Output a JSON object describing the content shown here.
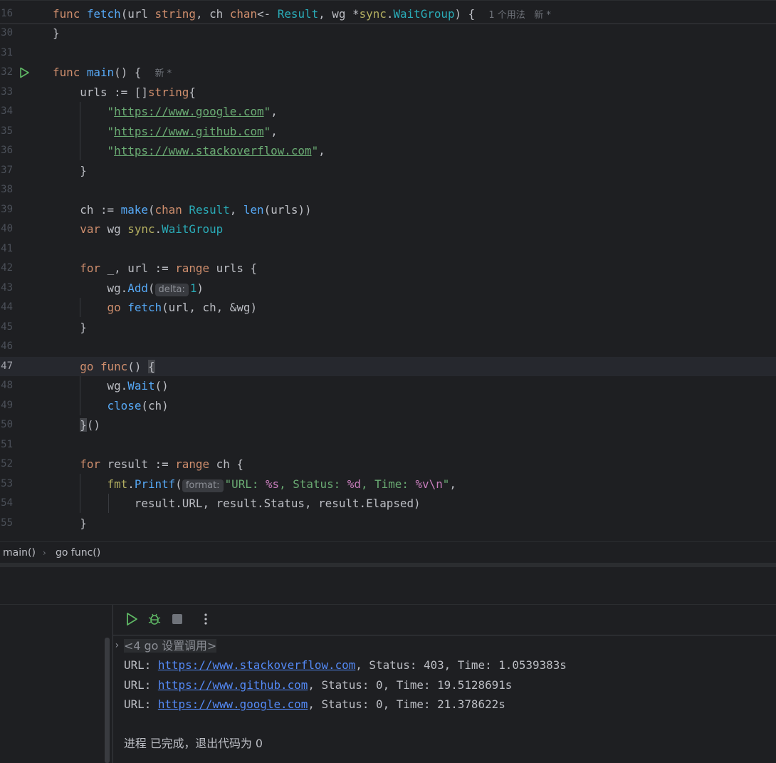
{
  "editor": {
    "sticky": {
      "line_no": "16",
      "tokens": [
        {
          "t": "func ",
          "c": "kw"
        },
        {
          "t": "fetch",
          "c": "fn"
        },
        {
          "t": "(url ",
          "c": ""
        },
        {
          "t": "string",
          "c": "kw"
        },
        {
          "t": ", ch ",
          "c": ""
        },
        {
          "t": "chan",
          "c": "kw"
        },
        {
          "t": "<- ",
          "c": ""
        },
        {
          "t": "Result",
          "c": "ty"
        },
        {
          "t": ", wg *",
          "c": ""
        },
        {
          "t": "sync",
          "c": "pk"
        },
        {
          "t": ".",
          "c": ""
        },
        {
          "t": "WaitGroup",
          "c": "ty"
        },
        {
          "t": ") {  ",
          "c": ""
        }
      ],
      "hint": "1 个用法   新 *"
    },
    "lines": [
      {
        "no": "30",
        "tokens": [
          {
            "t": "}",
            "c": ""
          }
        ]
      },
      {
        "no": "31",
        "tokens": []
      },
      {
        "no": "32",
        "run": true,
        "tokens": [
          {
            "t": "func ",
            "c": "kw"
          },
          {
            "t": "main",
            "c": "fn"
          },
          {
            "t": "() {  ",
            "c": ""
          }
        ],
        "hint": "新 *"
      },
      {
        "no": "33",
        "tokens": [
          {
            "t": "    urls := []",
            "c": ""
          },
          {
            "t": "string",
            "c": "kw"
          },
          {
            "t": "{",
            "c": ""
          }
        ]
      },
      {
        "no": "34",
        "tokens": [
          {
            "t": "        ",
            "c": ""
          },
          {
            "t": "\"",
            "c": "st"
          },
          {
            "t": "https://www.google.com",
            "c": "url"
          },
          {
            "t": "\"",
            "c": "st"
          },
          {
            "t": ",",
            "c": ""
          }
        ]
      },
      {
        "no": "35",
        "tokens": [
          {
            "t": "        ",
            "c": ""
          },
          {
            "t": "\"",
            "c": "st"
          },
          {
            "t": "https://www.github.com",
            "c": "url"
          },
          {
            "t": "\"",
            "c": "st"
          },
          {
            "t": ",",
            "c": ""
          }
        ]
      },
      {
        "no": "36",
        "tokens": [
          {
            "t": "        ",
            "c": ""
          },
          {
            "t": "\"",
            "c": "st"
          },
          {
            "t": "https://www.stackoverflow.com",
            "c": "url"
          },
          {
            "t": "\"",
            "c": "st"
          },
          {
            "t": ",",
            "c": ""
          }
        ]
      },
      {
        "no": "37",
        "tokens": [
          {
            "t": "    }",
            "c": ""
          }
        ]
      },
      {
        "no": "38",
        "tokens": []
      },
      {
        "no": "39",
        "tokens": [
          {
            "t": "    ch := ",
            "c": ""
          },
          {
            "t": "make",
            "c": "fn"
          },
          {
            "t": "(",
            "c": ""
          },
          {
            "t": "chan ",
            "c": "kw"
          },
          {
            "t": "Result",
            "c": "ty"
          },
          {
            "t": ", ",
            "c": ""
          },
          {
            "t": "len",
            "c": "fn"
          },
          {
            "t": "(urls))",
            "c": ""
          }
        ]
      },
      {
        "no": "40",
        "tokens": [
          {
            "t": "    ",
            "c": ""
          },
          {
            "t": "var ",
            "c": "kw"
          },
          {
            "t": "wg ",
            "c": ""
          },
          {
            "t": "sync",
            "c": "pk"
          },
          {
            "t": ".",
            "c": ""
          },
          {
            "t": "WaitGroup",
            "c": "ty"
          }
        ]
      },
      {
        "no": "41",
        "tokens": []
      },
      {
        "no": "42",
        "tokens": [
          {
            "t": "    ",
            "c": ""
          },
          {
            "t": "for ",
            "c": "kw"
          },
          {
            "t": "_, url := ",
            "c": ""
          },
          {
            "t": "range ",
            "c": "kw"
          },
          {
            "t": "urls {",
            "c": ""
          }
        ]
      },
      {
        "no": "43",
        "tokens": [
          {
            "t": "        wg.",
            "c": ""
          },
          {
            "t": "Add",
            "c": "fn"
          },
          {
            "t": "(",
            "c": ""
          },
          {
            "t": "delta:",
            "c": "param"
          },
          {
            "t": "1",
            "c": "num"
          },
          {
            "t": ")",
            "c": ""
          }
        ]
      },
      {
        "no": "44",
        "tokens": [
          {
            "t": "        ",
            "c": ""
          },
          {
            "t": "go ",
            "c": "kw"
          },
          {
            "t": "fetch",
            "c": "fn"
          },
          {
            "t": "(url, ch, &wg)",
            "c": ""
          }
        ]
      },
      {
        "no": "45",
        "tokens": [
          {
            "t": "    }",
            "c": ""
          }
        ]
      },
      {
        "no": "46",
        "tokens": []
      },
      {
        "no": "47",
        "current": true,
        "tokens": [
          {
            "t": "    ",
            "c": ""
          },
          {
            "t": "go ",
            "c": "kw"
          },
          {
            "t": "func",
            "c": "kw"
          },
          {
            "t": "() ",
            "c": ""
          },
          {
            "t": "{",
            "c": "brace"
          }
        ]
      },
      {
        "no": "48",
        "tokens": [
          {
            "t": "        wg.",
            "c": ""
          },
          {
            "t": "Wait",
            "c": "fn"
          },
          {
            "t": "()",
            "c": ""
          }
        ]
      },
      {
        "no": "49",
        "tokens": [
          {
            "t": "        ",
            "c": ""
          },
          {
            "t": "close",
            "c": "fn"
          },
          {
            "t": "(ch)",
            "c": ""
          }
        ]
      },
      {
        "no": "50",
        "tokens": [
          {
            "t": "    ",
            "c": ""
          },
          {
            "t": "}",
            "c": "brace"
          },
          {
            "t": "()",
            "c": ""
          }
        ]
      },
      {
        "no": "51",
        "tokens": []
      },
      {
        "no": "52",
        "tokens": [
          {
            "t": "    ",
            "c": ""
          },
          {
            "t": "for ",
            "c": "kw"
          },
          {
            "t": "result := ",
            "c": ""
          },
          {
            "t": "range ",
            "c": "kw"
          },
          {
            "t": "ch {",
            "c": ""
          }
        ]
      },
      {
        "no": "53",
        "tokens": [
          {
            "t": "        ",
            "c": ""
          },
          {
            "t": "fmt",
            "c": "pk"
          },
          {
            "t": ".",
            "c": ""
          },
          {
            "t": "Printf",
            "c": "fn"
          },
          {
            "t": "(",
            "c": ""
          },
          {
            "t": "format:",
            "c": "param"
          },
          {
            "t": "\"URL: ",
            "c": "st"
          },
          {
            "t": "%s",
            "c": "ci"
          },
          {
            "t": ", Status: ",
            "c": "st"
          },
          {
            "t": "%d",
            "c": "ci"
          },
          {
            "t": ", Time: ",
            "c": "st"
          },
          {
            "t": "%v",
            "c": "ci"
          },
          {
            "t": "\\n",
            "c": "ci"
          },
          {
            "t": "\"",
            "c": "st"
          },
          {
            "t": ",",
            "c": ""
          }
        ]
      },
      {
        "no": "54",
        "tokens": [
          {
            "t": "            result.URL, result.Status, result.Elapsed)",
            "c": ""
          }
        ]
      },
      {
        "no": "55",
        "tokens": [
          {
            "t": "    }",
            "c": ""
          }
        ]
      }
    ]
  },
  "breadcrumb": {
    "item1": "main()",
    "item2": "go func()"
  },
  "console": {
    "header": "<4 go 设置调用>",
    "lines": [
      {
        "prefix": "URL: ",
        "link": "https://www.stackoverflow.com",
        "suffix": ", Status: 403, Time: 1.0539383s"
      },
      {
        "prefix": "URL: ",
        "link": "https://www.github.com",
        "suffix": ", Status: 0, Time: 19.5128691s"
      },
      {
        "prefix": "URL: ",
        "link": "https://www.google.com",
        "suffix": ", Status: 0, Time: 21.378622s"
      }
    ],
    "exit": "进程 已完成，退出代码为 0"
  },
  "toolbar": {
    "icons": [
      "rerun-icon",
      "debug-icon",
      "stop-icon",
      "more-options-icon"
    ]
  },
  "colors": {
    "keyword": "#cf8e6d",
    "function": "#56a8f5",
    "type": "#2aacb8",
    "string": "#6aab73",
    "link": "#548af7",
    "run_icon": "#5fb865"
  }
}
